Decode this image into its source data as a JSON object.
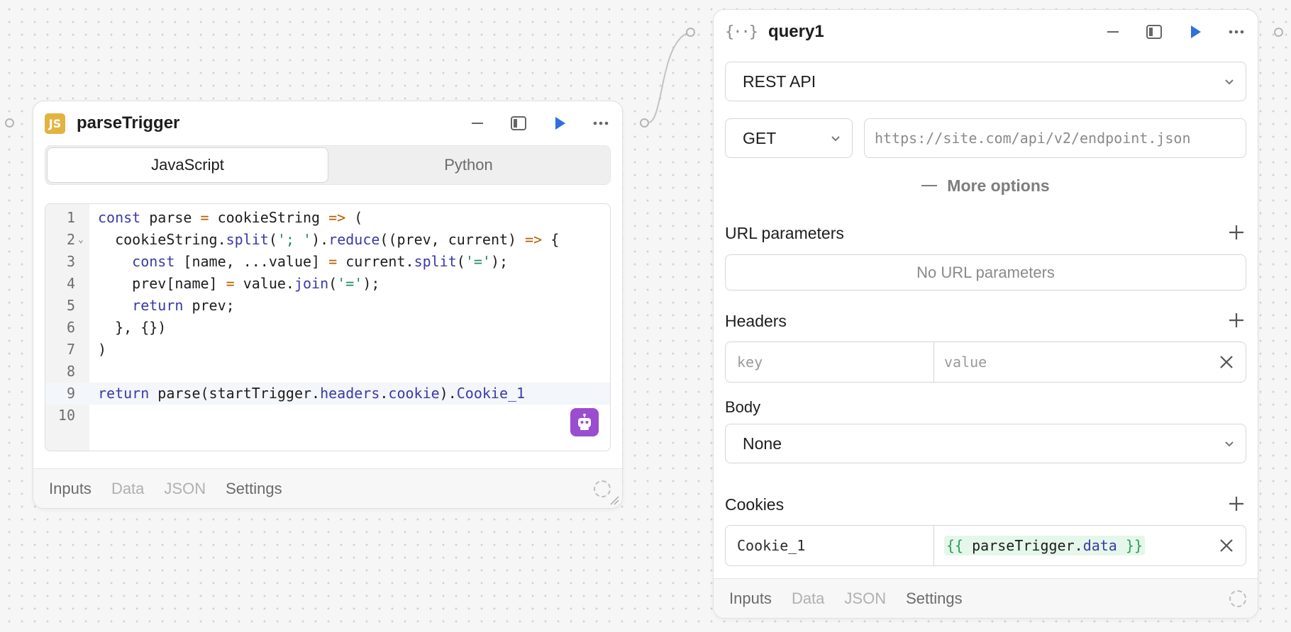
{
  "canvas": {
    "connector_color": "#b5b5b5"
  },
  "parse_block": {
    "badge": "JS",
    "title": "parseTrigger",
    "header_icons": [
      "minimize-icon",
      "sidebar-icon",
      "run-icon",
      "more-icon"
    ],
    "language_tabs": [
      {
        "label": "JavaScript",
        "active": true
      },
      {
        "label": "Python",
        "active": false
      }
    ],
    "code_lines": [
      {
        "n": "1",
        "html": "<span class='kw'>const</span> parse <span class='op'>=</span> cookieString <span class='op'>=&gt;</span> ("
      },
      {
        "n": "2",
        "fold": true,
        "html": "  cookieString.<span class='fn'>split</span>(<span class='str'>'; '</span>).<span class='fn'>reduce</span>((prev, current) <span class='op'>=&gt;</span> {"
      },
      {
        "n": "3",
        "html": "    <span class='kw'>const</span> [name, ...value] <span class='op'>=</span> current.<span class='fn'>split</span>(<span class='str'>'='</span>);"
      },
      {
        "n": "4",
        "html": "    prev[name] <span class='op'>=</span> value.<span class='fn'>join</span>(<span class='str'>'='</span>);"
      },
      {
        "n": "5",
        "html": "    <span class='kw'>return</span> prev;"
      },
      {
        "n": "6",
        "html": "  }, {})"
      },
      {
        "n": "7",
        "html": ")"
      },
      {
        "n": "8",
        "html": ""
      },
      {
        "n": "9",
        "current": true,
        "html": "<span class='kw'>return</span> parse(startTrigger.<span class='fn'>headers</span>.<span class='fn'>cookie</span>).<span class='fn'>Cookie_1</span>"
      },
      {
        "n": "10",
        "html": ""
      }
    ],
    "ai_icon": "robot-icon",
    "footer_tabs": [
      {
        "label": "Inputs",
        "strong": true
      },
      {
        "label": "Data",
        "strong": false
      },
      {
        "label": "JSON",
        "strong": false
      },
      {
        "label": "Settings",
        "strong": true
      }
    ]
  },
  "query_block": {
    "icon": "{··}",
    "title": "query1",
    "header_icons": [
      "minimize-icon",
      "sidebar-icon",
      "run-icon",
      "more-icon"
    ],
    "resource": "REST API",
    "method": "GET",
    "url_placeholder": "https://site.com/api/v2/endpoint.json",
    "more_options": "More options",
    "url_params": {
      "title": "URL parameters",
      "empty": "No URL parameters"
    },
    "headers": {
      "title": "Headers",
      "key_placeholder": "key",
      "value_placeholder": "value"
    },
    "body": {
      "title": "Body",
      "value": "None"
    },
    "cookies": {
      "title": "Cookies",
      "key": "Cookie_1",
      "value_open": "{{",
      "value_ref": "parseTrigger",
      "value_dot": ".",
      "value_prop": "data",
      "value_close": "}}"
    },
    "footer_tabs": [
      {
        "label": "Inputs",
        "strong": true
      },
      {
        "label": "Data",
        "strong": false
      },
      {
        "label": "JSON",
        "strong": false
      },
      {
        "label": "Settings",
        "strong": true
      }
    ]
  },
  "colors": {
    "run_blue": "#2f6fde",
    "ai_purple": "#9a4dcf",
    "js_badge": "#e3b341"
  }
}
